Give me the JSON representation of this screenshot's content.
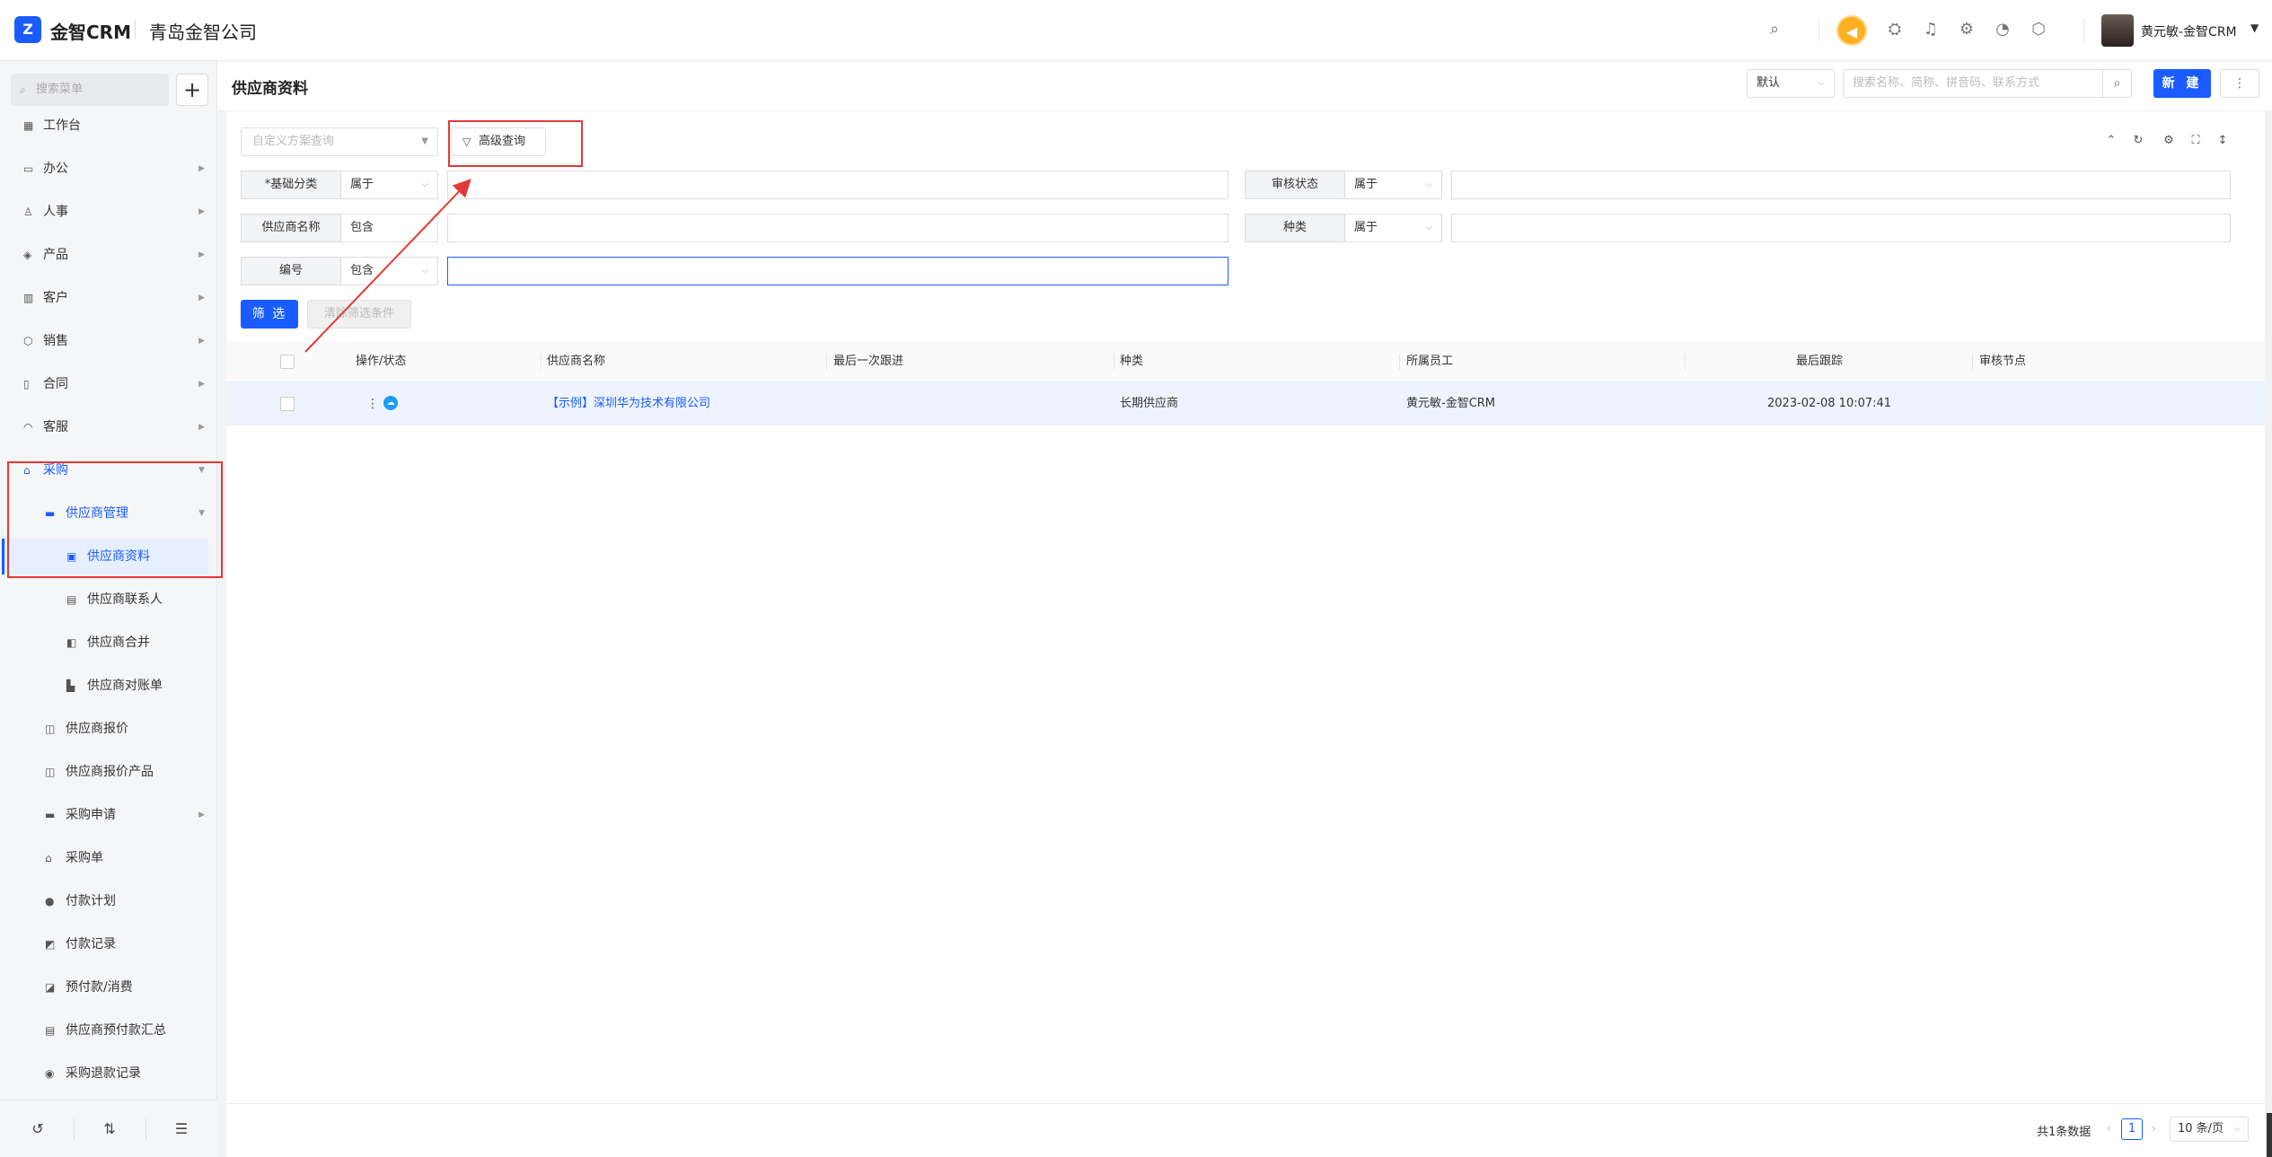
{
  "header": {
    "brand": "金智CRM",
    "company": "青岛金智公司",
    "username": "黄元敏-金智CRM"
  },
  "sidebar": {
    "search_placeholder": "搜索菜单",
    "items": [
      {
        "label": "工作台",
        "icon": "dashboard-icon"
      },
      {
        "label": "办公",
        "icon": "monitor-icon"
      },
      {
        "label": "人事",
        "icon": "people-icon"
      },
      {
        "label": "产品",
        "icon": "box-icon"
      },
      {
        "label": "客户",
        "icon": "chart-icon"
      },
      {
        "label": "销售",
        "icon": "cube-icon"
      },
      {
        "label": "合同",
        "icon": "document-icon"
      },
      {
        "label": "客服",
        "icon": "headset-icon"
      },
      {
        "label": "采购",
        "icon": "basket-icon"
      },
      {
        "label": "供应商管理",
        "icon": "folder-icon"
      },
      {
        "label": "供应商资料",
        "icon": "card-icon"
      },
      {
        "label": "供应商联系人",
        "icon": "contact-icon"
      },
      {
        "label": "供应商合并",
        "icon": "merge-icon"
      },
      {
        "label": "供应商对账单",
        "icon": "stamp-icon"
      },
      {
        "label": "供应商报价",
        "icon": "quote-icon"
      },
      {
        "label": "供应商报价产品",
        "icon": "quote-icon"
      },
      {
        "label": "采购申请",
        "icon": "folder-icon"
      },
      {
        "label": "采购单",
        "icon": "basket-icon"
      },
      {
        "label": "付款计划",
        "icon": "plan-icon"
      },
      {
        "label": "付款记录",
        "icon": "record-icon"
      },
      {
        "label": "预付款/消费",
        "icon": "wallet-icon"
      },
      {
        "label": "供应商预付款汇总",
        "icon": "summary-icon"
      },
      {
        "label": "采购退款记录",
        "icon": "refund-icon"
      }
    ]
  },
  "content": {
    "page_title": "供应商资料",
    "view_select": "默认",
    "search_placeholder": "搜索名称、简称、拼音码、联系方式",
    "new_label": "新 建",
    "more_label": "⋮"
  },
  "filters": {
    "custom_placeholder": "自定义方案查询",
    "advanced_label": "高级查询",
    "rows": [
      {
        "label": "*基础分类",
        "op": "属于",
        "value": "."
      },
      {
        "label": "审核状态",
        "op": "属于",
        "value": ""
      },
      {
        "label": "供应商名称",
        "op": "包含",
        "value": ""
      },
      {
        "label": "种类",
        "op": "属于",
        "value": ""
      },
      {
        "label": "编号",
        "op": "包含",
        "value": ""
      }
    ],
    "filter_btn": "筛 选",
    "clear_btn": "清除筛选条件"
  },
  "table": {
    "columns": [
      "操作/状态",
      "供应商名称",
      "最后一次跟进",
      "种类",
      "所属员工",
      "最后跟踪",
      "审核节点"
    ],
    "rows": [
      {
        "name": "【示例】深圳华为技术有限公司",
        "last_follow": "",
        "kind": "长期供应商",
        "employee": "黄元敏-金智CRM",
        "last_track": "2023-02-08 10:07:41",
        "audit": ""
      }
    ]
  },
  "pager": {
    "total": "共1条数据",
    "page": "1",
    "size": "10 条/页"
  },
  "colors": {
    "accent": "#1a5cff",
    "highlight_box": "#e53935",
    "notice": "#ffb022"
  }
}
